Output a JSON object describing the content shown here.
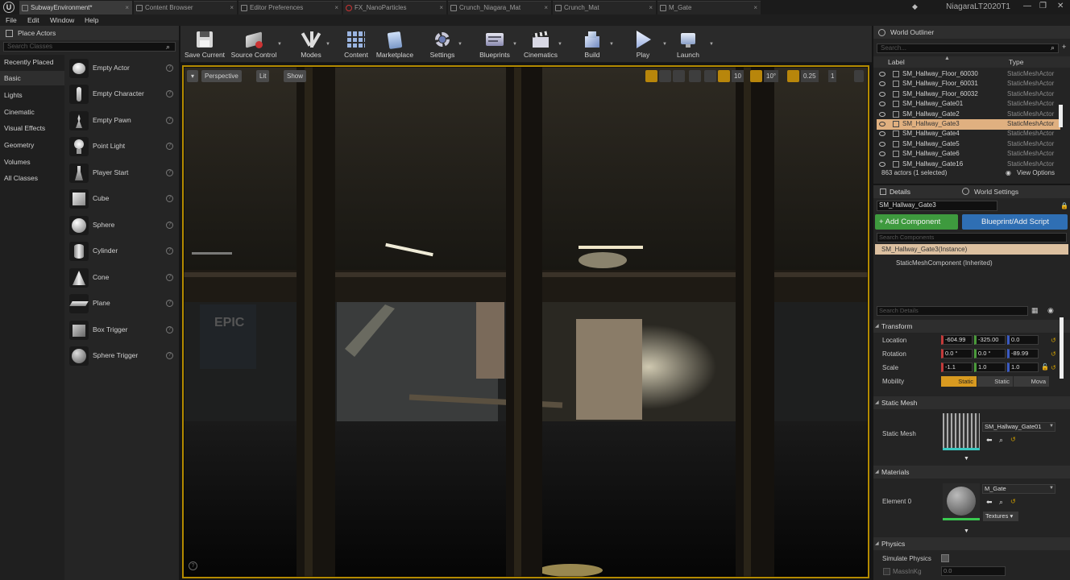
{
  "tabs": [
    {
      "label": "SubwayEnvironment*"
    },
    {
      "label": "Content Browser"
    },
    {
      "label": "Editor Preferences"
    },
    {
      "label": "FX_NanoParticles"
    },
    {
      "label": "Crunch_Niagara_Mat"
    },
    {
      "label": "Crunch_Mat"
    },
    {
      "label": "M_Gate"
    }
  ],
  "project_name": "NiagaraLT2020T1",
  "menu": {
    "file": "File",
    "edit": "Edit",
    "window": "Window",
    "help": "Help"
  },
  "place_actors": {
    "title": "Place Actors",
    "search_placeholder": "Search Classes",
    "categories": [
      "Recently Placed",
      "Basic",
      "Lights",
      "Cinematic",
      "Visual Effects",
      "Geometry",
      "Volumes",
      "All Classes"
    ],
    "selected_category": "Basic",
    "items": [
      "Empty Actor",
      "Empty Character",
      "Empty Pawn",
      "Point Light",
      "Player Start",
      "Cube",
      "Sphere",
      "Cylinder",
      "Cone",
      "Plane",
      "Box Trigger",
      "Sphere Trigger"
    ]
  },
  "toolbar": {
    "save": "Save Current",
    "source_control": "Source Control",
    "modes": "Modes",
    "content": "Content",
    "marketplace": "Marketplace",
    "settings": "Settings",
    "blueprints": "Blueprints",
    "cinematics": "Cinematics",
    "build": "Build",
    "play": "Play",
    "launch": "Launch"
  },
  "viewport": {
    "perspective": "Perspective",
    "lit": "Lit",
    "show": "Show",
    "grid_snap": "10",
    "rot_snap": "10°",
    "scale_snap": "0.25",
    "camera_speed": "1",
    "poster_text": "EPIC"
  },
  "outliner": {
    "title": "World Outliner",
    "search_placeholder": "Search...",
    "col_label": "Label",
    "col_type": "Type",
    "rows": [
      {
        "name": "SM_Hallway_Floor_60030",
        "type": "StaticMeshActor"
      },
      {
        "name": "SM_Hallway_Floor_60031",
        "type": "StaticMeshActor"
      },
      {
        "name": "SM_Hallway_Floor_60032",
        "type": "StaticMeshActor"
      },
      {
        "name": "SM_Hallway_Gate01",
        "type": "StaticMeshActor"
      },
      {
        "name": "SM_Hallway_Gate2",
        "type": "StaticMeshActor"
      },
      {
        "name": "SM_Hallway_Gate3",
        "type": "StaticMeshActor"
      },
      {
        "name": "SM_Hallway_Gate4",
        "type": "StaticMeshActor"
      },
      {
        "name": "SM_Hallway_Gate5",
        "type": "StaticMeshActor"
      },
      {
        "name": "SM_Hallway_Gate6",
        "type": "StaticMeshActor"
      },
      {
        "name": "SM_Hallway_Gate16",
        "type": "StaticMeshActor"
      }
    ],
    "selected_row": "SM_Hallway_Gate3",
    "count": "863 actors (1 selected)",
    "view_options": "View Options"
  },
  "details": {
    "tab_details": "Details",
    "tab_world": "World Settings",
    "actor_name": "SM_Hallway_Gate3",
    "add_component": "+ Add Component",
    "blueprint_script": "Blueprint/Add Script",
    "search_components": "Search Components",
    "instance": "SM_Hallway_Gate3(Instance)",
    "component": "StaticMeshComponent (Inherited)",
    "search_details": "Search Details",
    "transform": "Transform",
    "location_label": "Location",
    "rotation_label": "Rotation",
    "scale_label": "Scale",
    "mobility_label": "Mobility",
    "location": [
      "-604.99",
      "-325.00",
      "0.0"
    ],
    "rotation": [
      "0.0 °",
      "0.0 °",
      "-89.99"
    ],
    "scale": [
      "-1.1",
      "1.0",
      "1.0"
    ],
    "mobility": [
      "Static",
      "Static",
      "Mova"
    ],
    "static_mesh_section": "Static Mesh",
    "static_mesh_label": "Static Mesh",
    "static_mesh_value": "SM_Hallway_Gate01",
    "materials_section": "Materials",
    "element0_label": "Element 0",
    "material_value": "M_Gate",
    "textures": "Textures",
    "physics_section": "Physics",
    "simulate_physics": "Simulate Physics",
    "mass_label": "MassInKg",
    "mass_value": "0.0"
  }
}
